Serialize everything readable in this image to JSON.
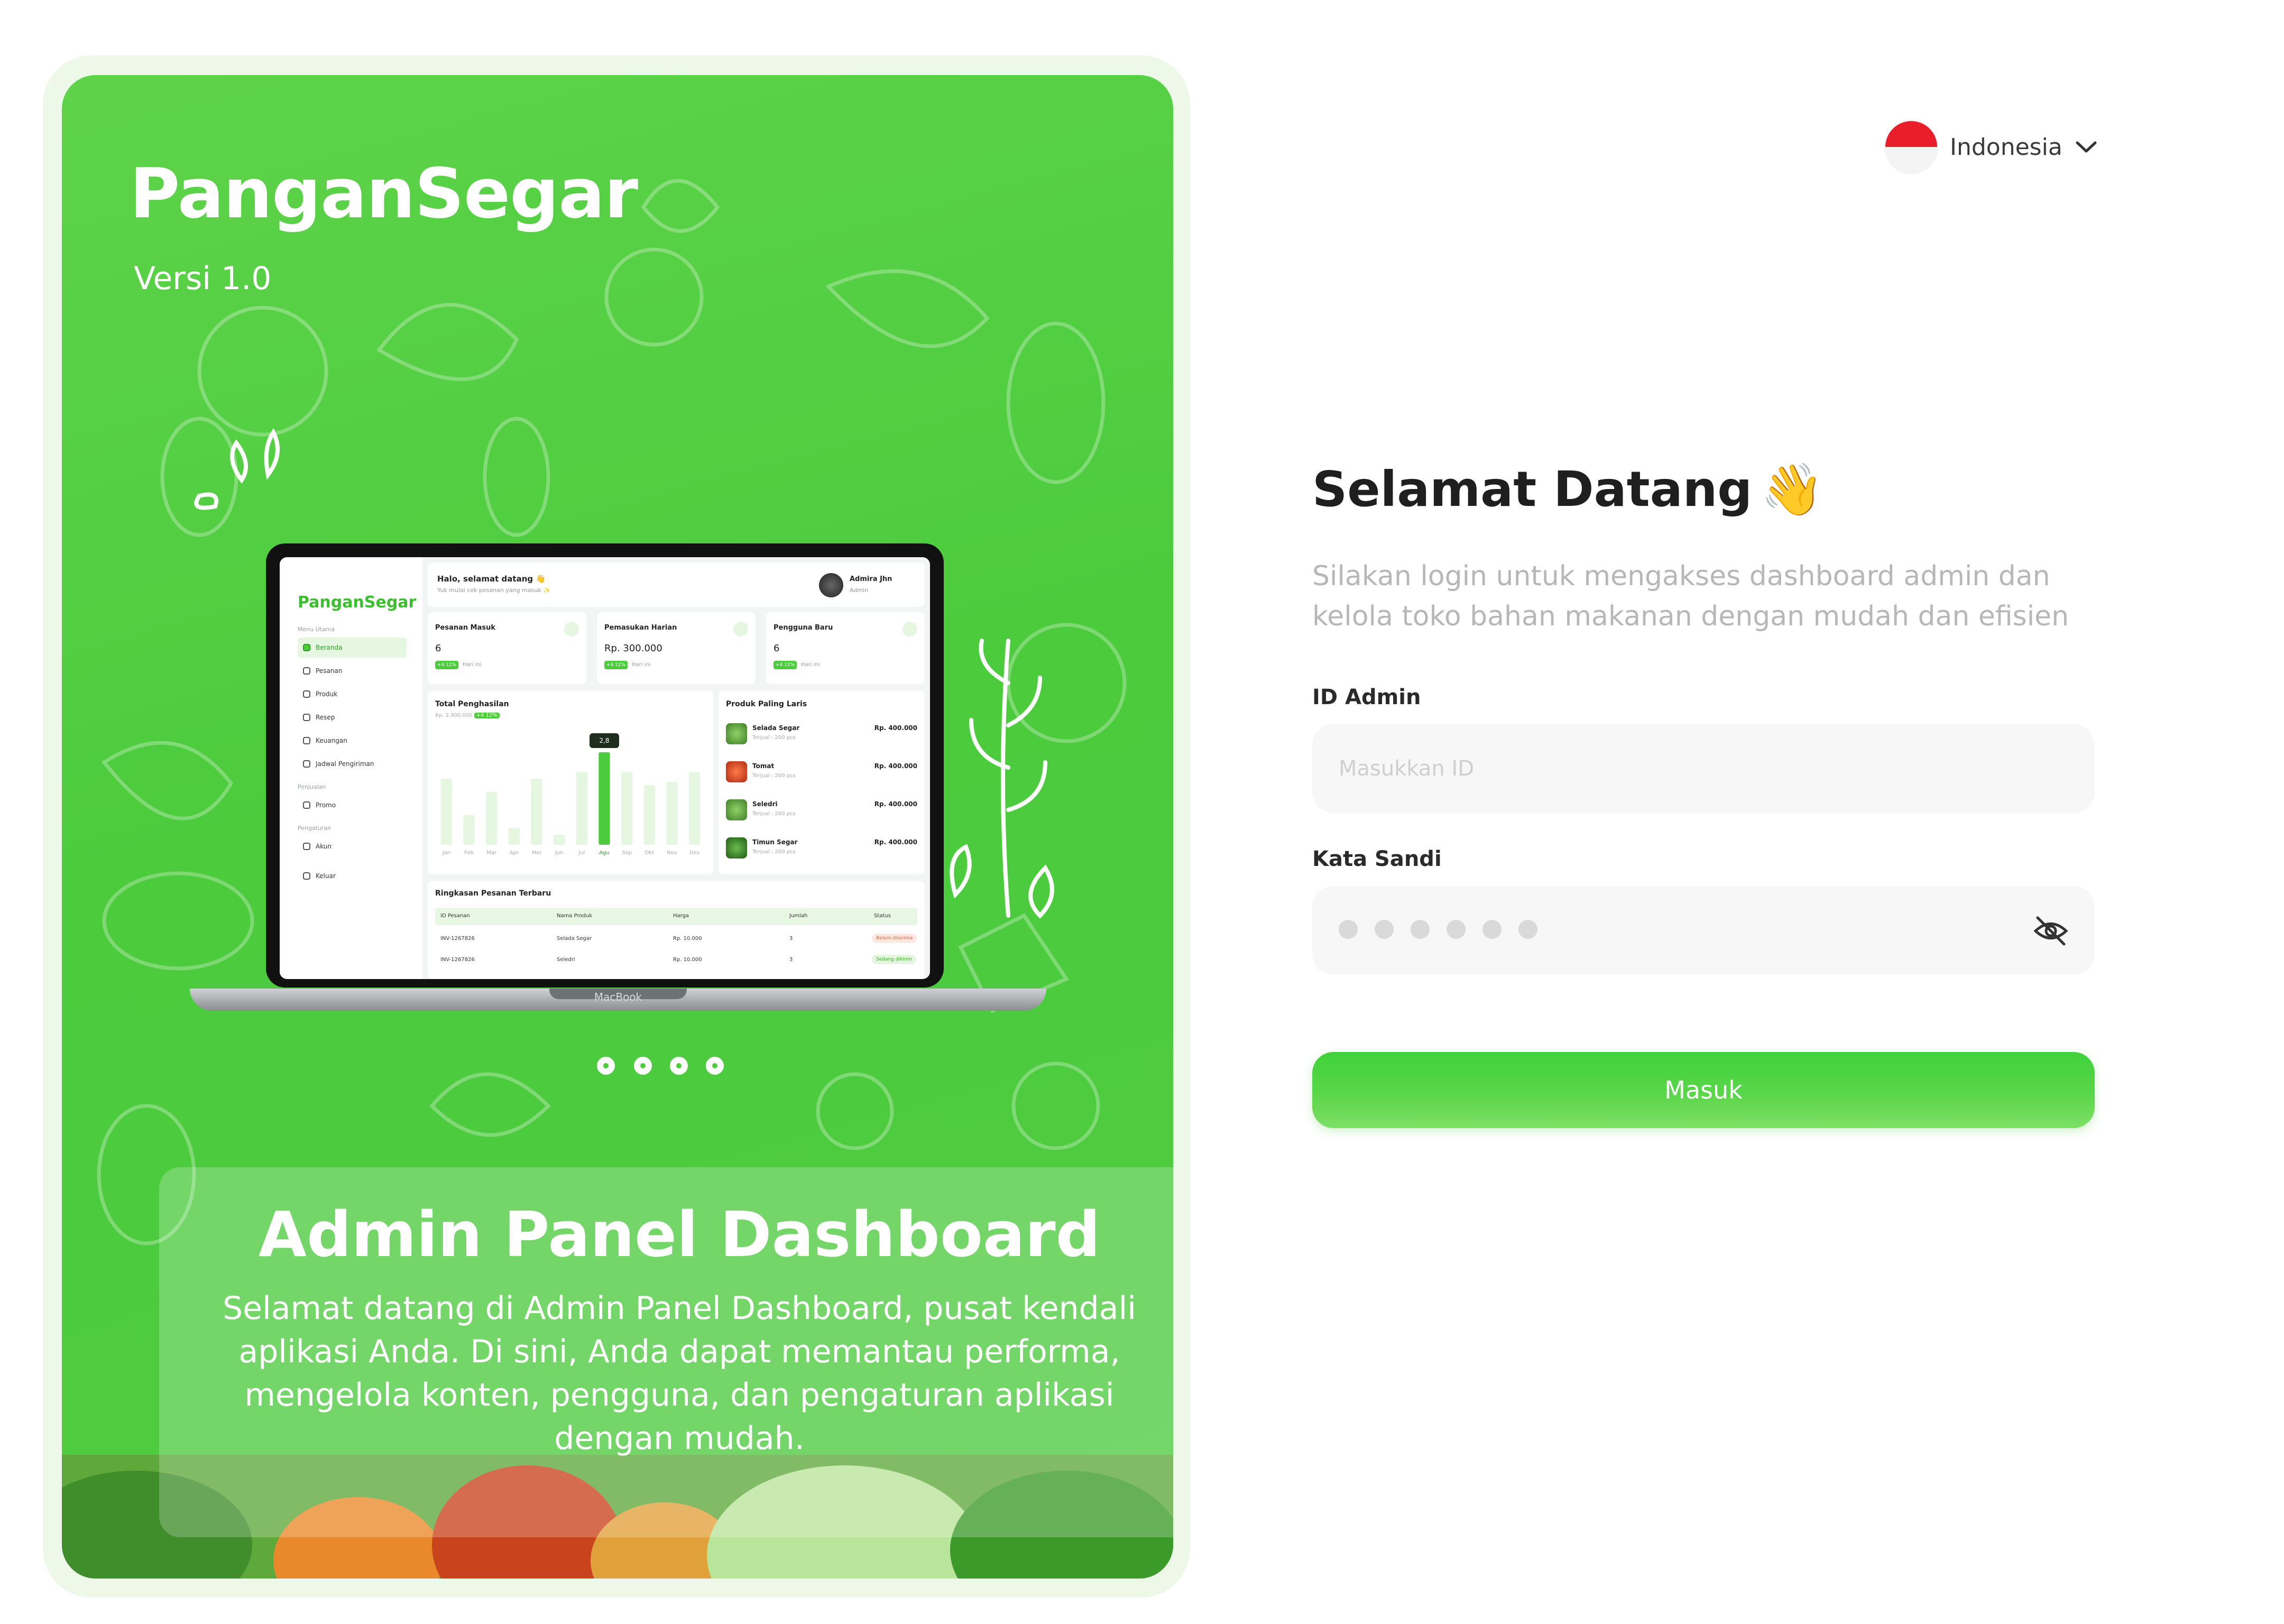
{
  "hero": {
    "brand": "PanganSegar",
    "version": "Versi 1.0",
    "title": "Admin Panel Dashboard",
    "description": "Selamat datang di Admin Panel Dashboard, pusat kendali aplikasi Anda. Di sini, Anda dapat memantau performa, mengelola konten, pengguna, dan pengaturan aplikasi dengan mudah.",
    "carousel_count": 4,
    "carousel_active": 3
  },
  "mockup": {
    "brand": "PanganSegar",
    "laptop_label": "MacBook",
    "greeting": "Halo, selamat datang 👋",
    "greeting_sub": "Yuk mulai cek pesanan yang masuk ✨",
    "user_name": "Admira Jhn",
    "user_role": "Admin",
    "menu_sections": [
      "Menu Utama",
      "Penjualan",
      "Pengaturan"
    ],
    "menu_items": [
      "Beranda",
      "Pesanan",
      "Produk",
      "Resep",
      "Keuangan",
      "Jadwal Pengiriman",
      "Promo",
      "Akun",
      "Keluar"
    ],
    "stats": [
      {
        "title": "Pesanan Masuk",
        "value": "6",
        "badge": "+4 12%",
        "note": "Hari ini"
      },
      {
        "title": "Pemasukan Harian",
        "value": "Rp. 300.000",
        "badge": "+4 12%",
        "note": "Hari ini"
      },
      {
        "title": "Pengguna Baru",
        "value": "6",
        "badge": "+4 12%",
        "note": "Hari ini"
      }
    ],
    "revenue": {
      "title": "Total Penghasilan",
      "sub": "Rp. 2.900.000",
      "sub_badge": "+4 12%",
      "tooltip": "2,8"
    },
    "best_title": "Produk Paling Laris",
    "products": [
      {
        "name": "Selada Segar",
        "sold": "Terjual : 200 pcs",
        "price": "Rp. 400.000"
      },
      {
        "name": "Tomat",
        "sold": "Terjual : 200 pcs",
        "price": "Rp. 400.000"
      },
      {
        "name": "Seledri",
        "sold": "Terjual : 200 pcs",
        "price": "Rp. 400.000"
      },
      {
        "name": "Timun Segar",
        "sold": "Terjual : 200 pcs",
        "price": "Rp. 400.000"
      }
    ],
    "table_title": "Ringkasan Pesanan Terbaru",
    "table_headers": [
      "ID Pesanan",
      "Nama Produk",
      "Harga",
      "Jumlah",
      "Status"
    ],
    "table_rows": [
      [
        "INV-1267826",
        "Selada Segar",
        "Rp. 10.000",
        "3",
        "Belum diterima"
      ],
      [
        "INV-1267826",
        "Seledri",
        "Rp. 10.000",
        "3",
        "Sedang dikirim"
      ]
    ]
  },
  "chart_data": {
    "type": "bar",
    "title": "Total Penghasilan",
    "categories": [
      "Jan",
      "Feb",
      "Mar",
      "Apr",
      "Mei",
      "Jun",
      "Jul",
      "Agu",
      "Sep",
      "Okt",
      "Nov",
      "Des"
    ],
    "values": [
      2.0,
      0.9,
      1.6,
      0.5,
      2.0,
      0.3,
      2.2,
      2.8,
      2.2,
      1.8,
      1.9,
      2.2
    ],
    "highlight_index": 7,
    "ylim": [
      0,
      3.2
    ],
    "colors": {
      "bar": "#e6f7e1",
      "highlight": "#4ccb3d"
    }
  },
  "language": {
    "label": "Indonesia",
    "flag": "indonesia-flag-icon"
  },
  "login": {
    "title": "Selamat Datang",
    "wave": "👋",
    "intro": "Silakan login untuk mengakses dashboard admin dan kelola toko bahan makanan  dengan mudah dan efisien",
    "id_label": "ID Admin",
    "id_placeholder": "Masukkan ID",
    "password_label": "Kata Sandi",
    "password_dot_count": 6,
    "submit_label": "Masuk"
  },
  "colors": {
    "brand_green": "#4ccb3d",
    "field_bg": "#f7f7f7",
    "muted_text": "#b7b7b7"
  }
}
